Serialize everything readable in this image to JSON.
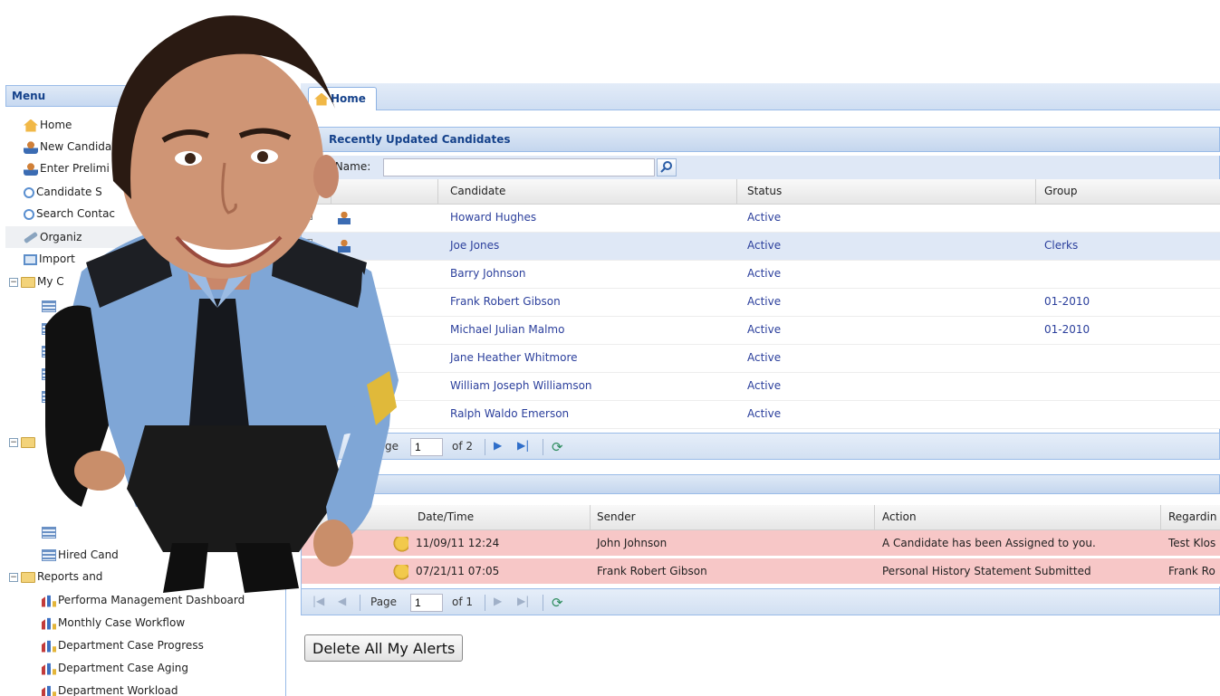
{
  "menu": {
    "title": "Menu",
    "items": [
      {
        "label": "Home"
      },
      {
        "label": "New Candida"
      },
      {
        "label": "Enter Prelimi"
      },
      {
        "label": "Candidate S"
      },
      {
        "label": "Search Contac"
      },
      {
        "label": "Organiz"
      },
      {
        "label": "Import"
      },
      {
        "label": "My C"
      },
      {
        "label": "Hired Cand"
      },
      {
        "label": "Reports and"
      },
      {
        "label": "Performa     Management Dashboard"
      },
      {
        "label": "Monthly Case Workflow"
      },
      {
        "label": "Department Case Progress"
      },
      {
        "label": "Department Case Aging"
      },
      {
        "label": "Department Workload"
      }
    ]
  },
  "tabs": [
    {
      "label": "Home"
    }
  ],
  "candidates": {
    "title": "Recently Updated Candidates",
    "search": {
      "label": "Last Name:",
      "value": ""
    },
    "columns": {
      "candidate": "Candidate",
      "status": "Status",
      "group": "Group"
    },
    "rows": [
      {
        "name": "Howard Hughes",
        "status": "Active",
        "group": ""
      },
      {
        "name": "Joe Jones",
        "status": "Active",
        "group": "Clerks"
      },
      {
        "name": "Barry Johnson",
        "status": "Active",
        "group": ""
      },
      {
        "name": "Frank Robert Gibson",
        "status": "Active",
        "group": "01-2010"
      },
      {
        "name": "Michael Julian Malmo",
        "status": "Active",
        "group": "01-2010"
      },
      {
        "name": "Jane Heather Whitmore",
        "status": "Active",
        "group": ""
      },
      {
        "name": "William Joseph Williamson",
        "status": "Active",
        "group": ""
      },
      {
        "name": "Ralph Waldo Emerson",
        "status": "Active",
        "group": ""
      }
    ],
    "pager": {
      "page_label": "ge",
      "page": "1",
      "of_label": "of 2"
    }
  },
  "alerts": {
    "columns": {
      "datetime": "Date/Time",
      "sender": "Sender",
      "action": "Action",
      "regarding": "Regardin"
    },
    "rows": [
      {
        "datetime": "11/09/11 12:24",
        "sender": "John Johnson",
        "action": "A Candidate has been Assigned to you.",
        "regarding": "Test Klos"
      },
      {
        "datetime": "07/21/11 07:05",
        "sender": "Frank Robert Gibson",
        "action": "Personal History Statement Submitted",
        "regarding": "Frank Ro"
      }
    ],
    "pager": {
      "page_label": "Page",
      "page": "1",
      "of_label": "of 1"
    },
    "delete_label": "Delete All My Alerts"
  },
  "colors": {
    "accent": "#15428b",
    "border": "#99bbe8",
    "alert_row": "#f7c7c7",
    "link": "#2b3f9c"
  }
}
